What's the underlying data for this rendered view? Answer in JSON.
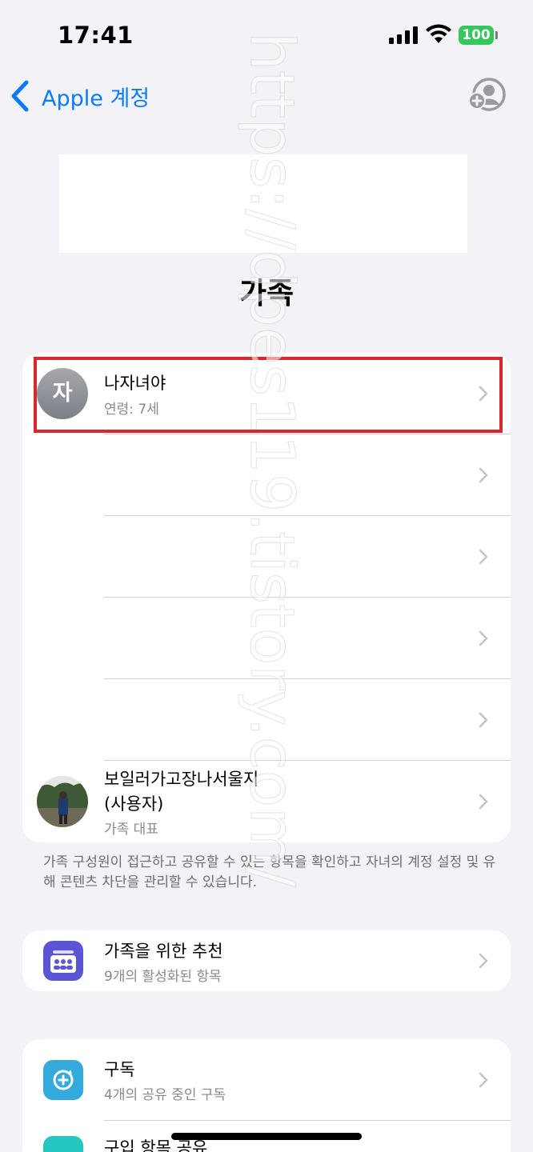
{
  "status_bar": {
    "time": "17:41",
    "battery": "100"
  },
  "nav": {
    "back_label": "Apple 계정"
  },
  "page": {
    "title": "가족"
  },
  "members": [
    {
      "initial": "자",
      "name": "나자녀야",
      "detail": "연령: 7세"
    },
    {
      "name": "보일러가고장나서울지\n(사용자)",
      "detail": "가족 대표"
    }
  ],
  "footnote": "가족 구성원이 접근하고 공유할 수 있는 항목을 확인하고 자녀의 계정 설정 및 유해 콘텐츠 차단을 관리할 수 있습니다.",
  "recommendations": {
    "title": "가족을 위한 추천",
    "detail": "9개의 활성화된 항목"
  },
  "subscriptions": {
    "title": "구독",
    "detail": "4개의 공유 중인 구독"
  },
  "purchase_sharing": {
    "title": "구입 항목 공유"
  },
  "watermark": "https://dpes119.tistory.com/",
  "colors": {
    "accent": "#0a7aff",
    "battery": "#34c759",
    "highlight": "#d9272e",
    "recommend_icon": "#5b55d6",
    "subscription_icon": "#34aadc",
    "purchase_icon": "#26c6c2"
  }
}
